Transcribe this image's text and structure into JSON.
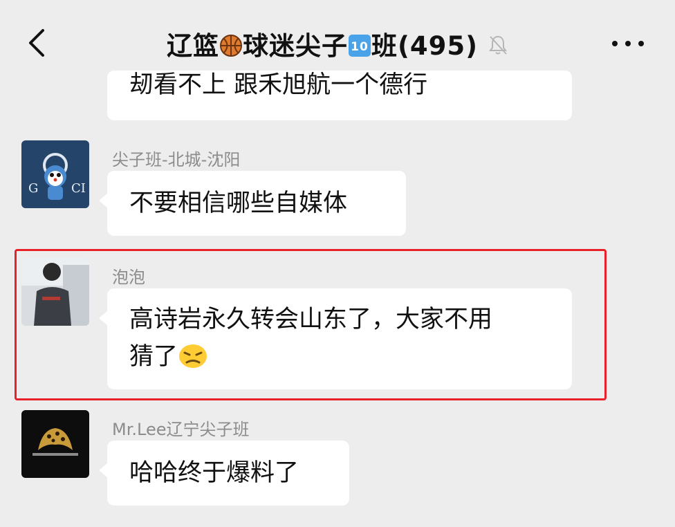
{
  "header": {
    "title_part1": "辽篮",
    "title_emoji1": "basketball",
    "title_part2": "球迷尖子",
    "title_emoji2": "keycap-10",
    "title_part3": "班(495)",
    "muted_icon": "bell-muted-icon",
    "more_icon": "more-dots-icon",
    "back_icon": "back-chevron-icon"
  },
  "messages": [
    {
      "sender": "",
      "text": "刼看不上 跟禾旭航一个德行"
    },
    {
      "sender": "尖子班-北城-沈阳",
      "text": "不要相信哪些自媒体",
      "avatar": "gucci-doraemon-avatar"
    },
    {
      "sender": "泡泡",
      "text_line1": "高诗岩永久转会山东了，大家不用",
      "text_line2": "猜了",
      "emoji": "persevering-face",
      "avatar": "person-photo-avatar"
    },
    {
      "sender": "Mr.Lee辽宁尖子班",
      "text": "哈哈终于爆料了",
      "avatar": "cheetah-logo-avatar"
    }
  ],
  "colors": {
    "background": "#ededed",
    "bubble": "#ffffff",
    "highlight_border": "#e8202a",
    "sender_text": "#8c8c8c"
  }
}
